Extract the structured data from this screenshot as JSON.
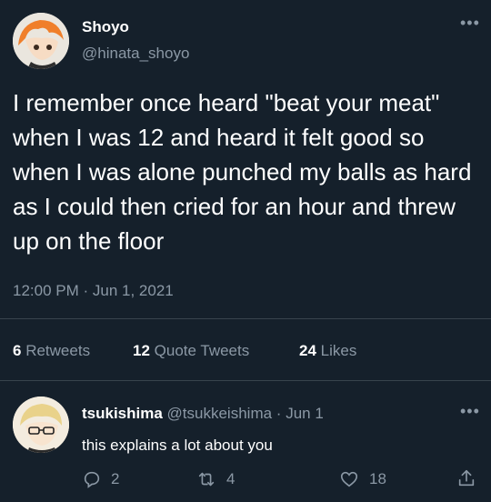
{
  "tweet": {
    "author_name": "Shoyo",
    "author_handle": "@hinata_shoyo",
    "text": "I remember once heard \"beat your meat\" when I was 12 and heard it felt good so when I was alone punched my balls as hard as I could then cried for an hour and threw up on the floor",
    "timestamp": "12:00 PM · Jun 1, 2021",
    "stats": {
      "retweets_count": "6",
      "retweets_label": "Retweets",
      "quote_count": "12",
      "quote_label": "Quote Tweets",
      "likes_count": "24",
      "likes_label": "Likes"
    },
    "more_icon": "more-horizontal-icon"
  },
  "reply": {
    "author_name": "tsukishima",
    "author_handle": "@tsukkeishima",
    "separator": "·",
    "date": "Jun 1",
    "text": "this explains a lot about you",
    "actions": {
      "reply_count": "2",
      "retweet_count": "4",
      "like_count": "18"
    }
  },
  "colors": {
    "background": "#15202b",
    "text": "#ffffff",
    "muted": "#8b98a5",
    "divider": "#38444d"
  }
}
